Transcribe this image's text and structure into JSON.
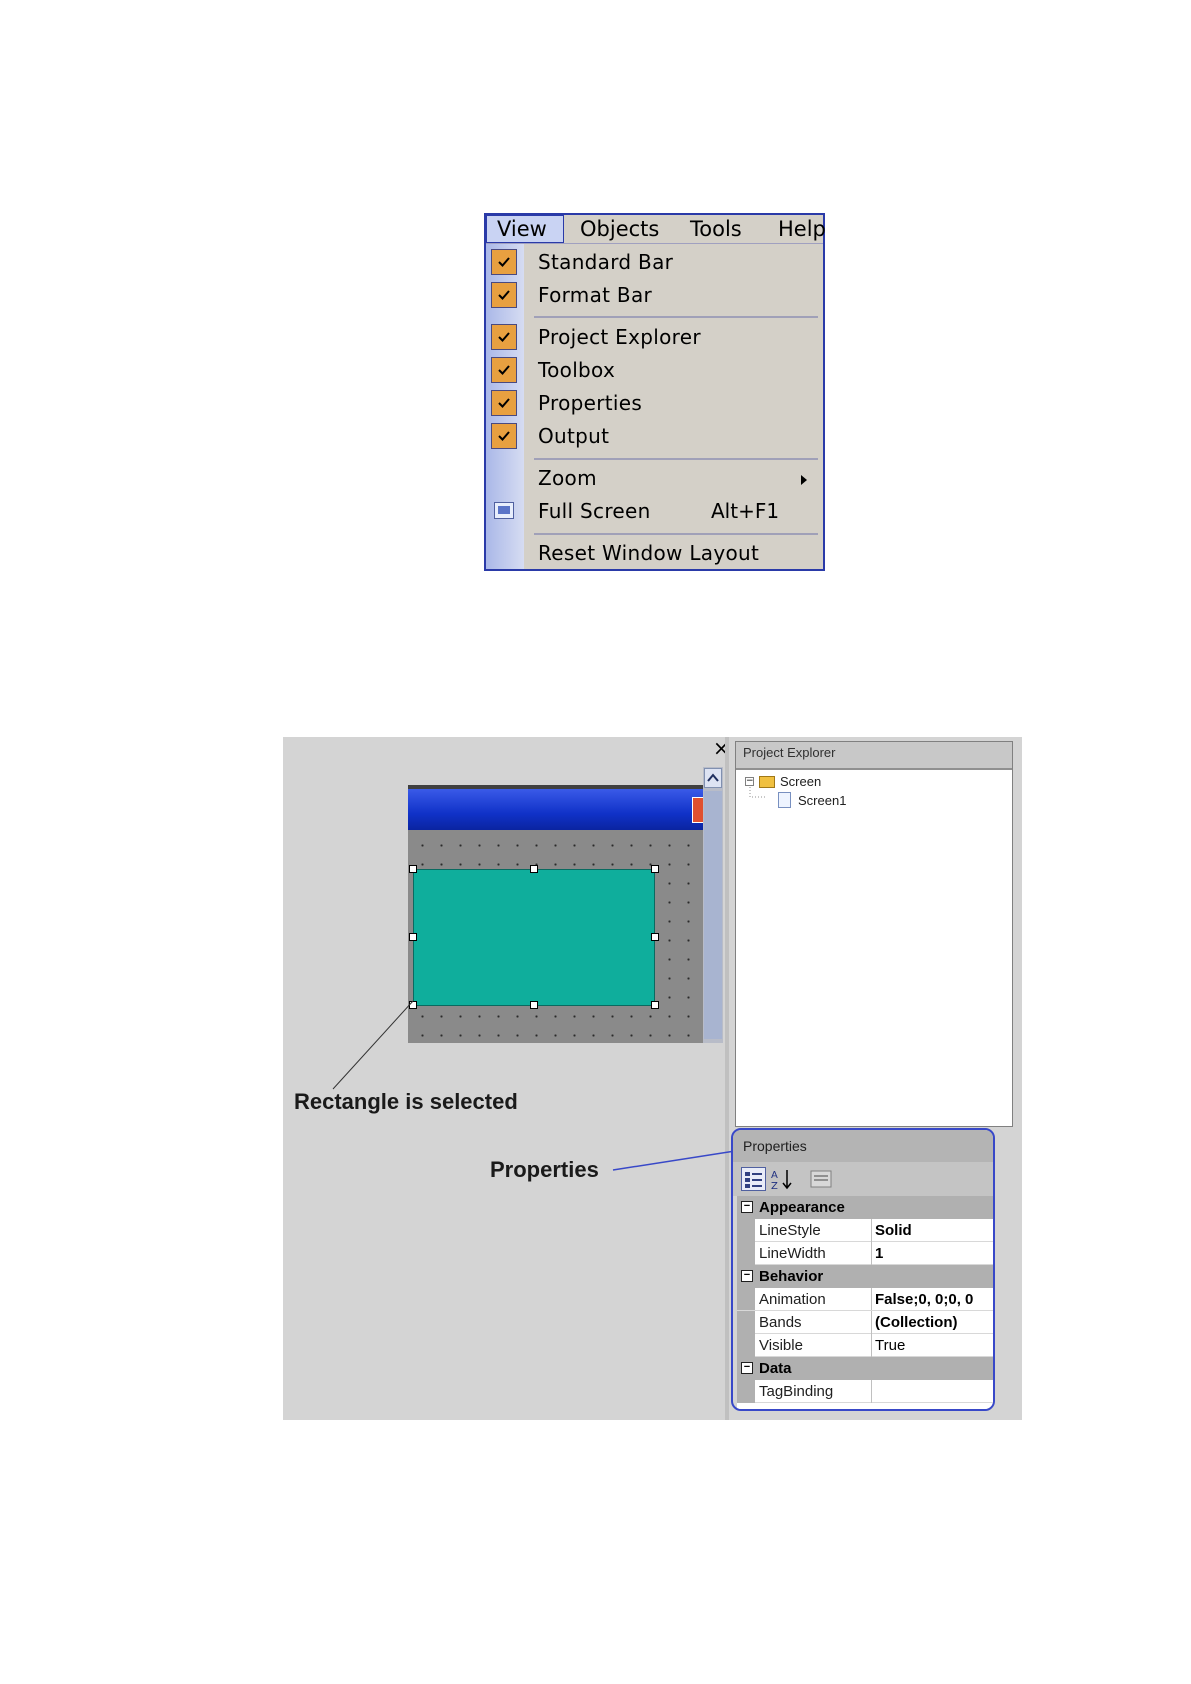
{
  "view_menu": {
    "menubar": [
      "View",
      "Objects",
      "Tools",
      "Help"
    ],
    "items": [
      {
        "label": "Standard Bar",
        "checked": true
      },
      {
        "label": "Format Bar",
        "checked": true
      },
      {
        "label": "Project Explorer",
        "checked": true
      },
      {
        "label": "Toolbox",
        "checked": true
      },
      {
        "label": "Properties",
        "checked": true
      },
      {
        "label": "Output",
        "checked": true
      },
      {
        "label": "Zoom",
        "submenu": true
      },
      {
        "label": "Full Screen",
        "shortcut": "Alt+F1",
        "icon": "full-screen-icon"
      },
      {
        "label": "Reset Window Layout"
      }
    ],
    "colors": {
      "check_bg": "#e8a040",
      "border": "#2a3aa8"
    }
  },
  "editor": {
    "captions": {
      "selected": "Rectangle is selected",
      "properties": "Properties"
    },
    "rectangle_color": "#0fae9c",
    "close_glyph": "×"
  },
  "project_explorer": {
    "title": "Project Explorer",
    "tree": [
      {
        "label": "Screen",
        "icon": "folder-icon"
      },
      {
        "label": "Screen1",
        "icon": "document-icon"
      }
    ]
  },
  "properties_panel": {
    "title": "Properties",
    "categories": [
      {
        "name": "Appearance",
        "rows": [
          {
            "name": "LineStyle",
            "value": "Solid"
          },
          {
            "name": "LineWidth",
            "value": "1"
          }
        ]
      },
      {
        "name": "Behavior",
        "rows": [
          {
            "name": "Animation",
            "value": "False;0, 0;0, 0"
          },
          {
            "name": "Bands",
            "value": "(Collection)"
          },
          {
            "name": "Visible",
            "value": "True"
          }
        ]
      },
      {
        "name": "Data",
        "rows": [
          {
            "name": "TagBinding",
            "value": ""
          }
        ]
      }
    ]
  }
}
